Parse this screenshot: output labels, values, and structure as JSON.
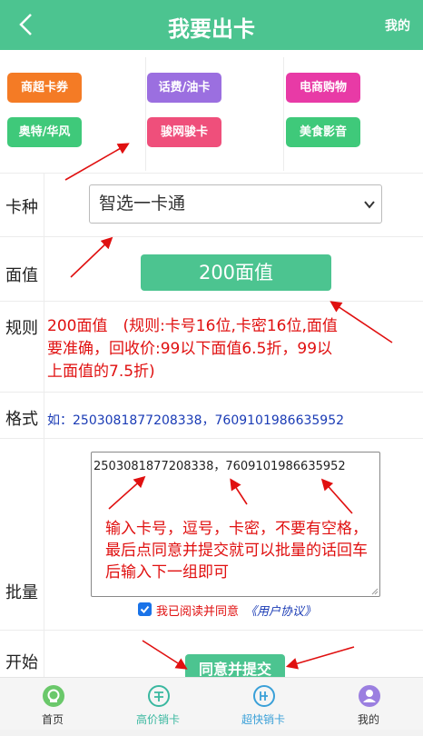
{
  "header": {
    "title": "我要出卡",
    "right_link": "我的"
  },
  "categories": [
    {
      "label": "商超卡券",
      "color": "#f47b25"
    },
    {
      "label": "话费/油卡",
      "color": "#9b6fe0"
    },
    {
      "label": "电商购物",
      "color": "#e83aa6"
    },
    {
      "label": "奥特/华风",
      "color": "#3fc97a"
    },
    {
      "label": "骏网骏卡",
      "color": "#ef4f7b"
    },
    {
      "label": "美食影音",
      "color": "#3fc97a"
    }
  ],
  "form": {
    "card_type_label": "卡种",
    "card_type_value": "智选一卡通",
    "face_value_label": "面值",
    "face_value": "200面值",
    "rules_label": "规则",
    "rules_text": "200面值　(规则:卡号16位,卡密16位,面值要准确，回收价:99以下面值6.5折，99以上面值的7.5折)",
    "format_label": "格式",
    "format_text": "如：2503081877208338，7609101986635952",
    "batch_label": "批量",
    "batch_value": "2503081877208338，7609101986635952",
    "batch_hint": "输入卡号，逗号，卡密，不要有空格，最后点同意并提交就可以批量的话回车后输入下一组即可",
    "agree_text": "我已阅读并同意",
    "agree_link": "《用户协议》",
    "agree_checked": true,
    "start_label": "开始",
    "submit_label": "同意并提交"
  },
  "tabbar": [
    {
      "label": "首页",
      "icon": "home-icon",
      "color": "#6ac86a"
    },
    {
      "label": "高价销卡",
      "icon": "sell-icon",
      "color": "#3ab8a0"
    },
    {
      "label": "超快销卡",
      "icon": "fast-icon",
      "color": "#3aa0d8"
    },
    {
      "label": "我的",
      "icon": "user-icon",
      "color": "#9b7fe0"
    }
  ],
  "colors": {
    "brand": "#4cc490",
    "annotation": "#e01010",
    "link": "#1a3bb5"
  }
}
